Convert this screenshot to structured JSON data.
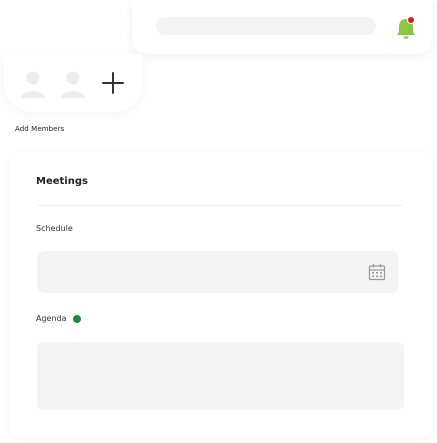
{
  "header": {
    "search_value": "",
    "notification_icon": "bell-icon",
    "accent_color": "#8dc63f"
  },
  "members": {
    "avatars": [
      "user-avatar-icon",
      "user-avatar-icon"
    ],
    "add_icon": "plus-icon",
    "add_label": "Add Members"
  },
  "meetings": {
    "title": "Meetings",
    "schedule_label": "Schedule",
    "schedule_value": "",
    "calendar_icon": "calendar-icon",
    "agenda_label": "Agenda",
    "agenda_status_color": "#1b8a3c",
    "agenda_value": ""
  }
}
